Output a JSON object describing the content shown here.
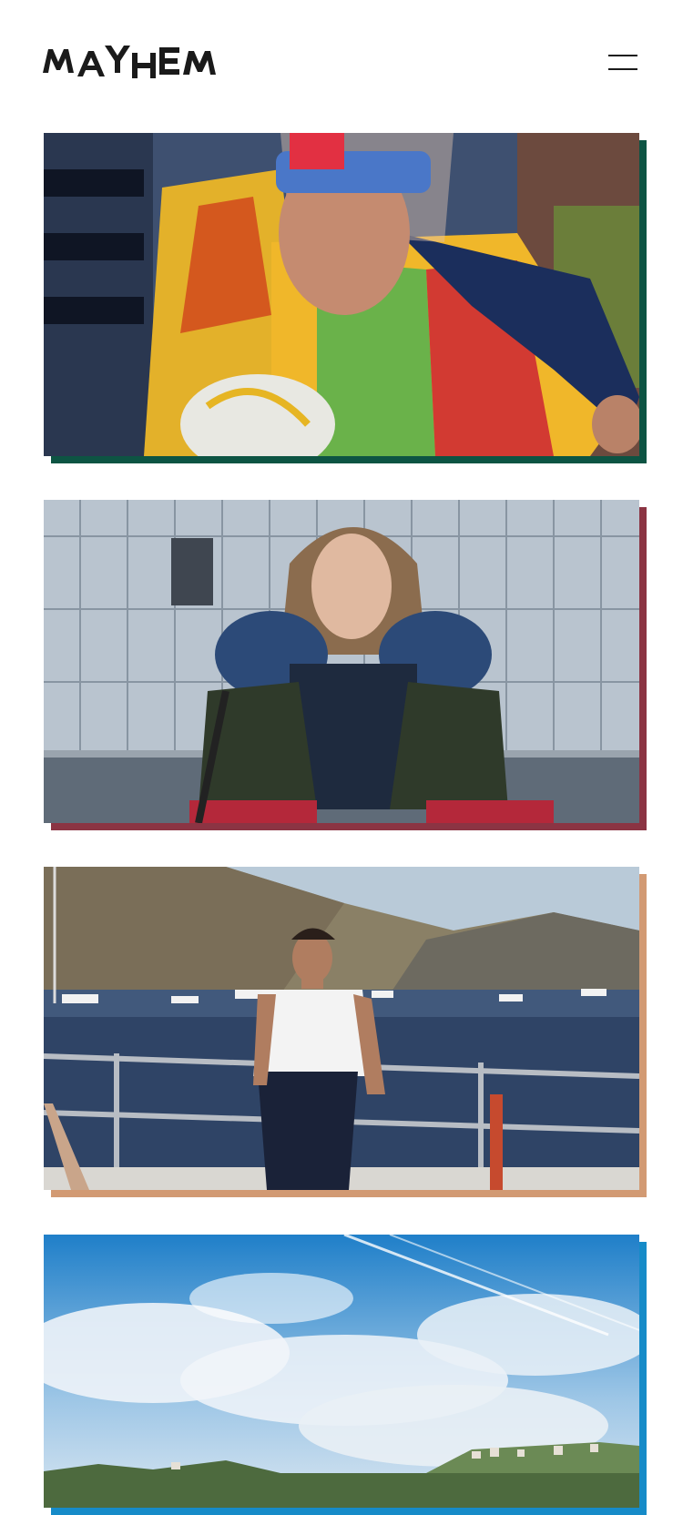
{
  "header": {
    "logo_text": "MAYHEM",
    "menu_icon": "hamburger-menu-icon"
  },
  "stories": [
    {
      "subject": "rugby-player-photo",
      "accent": "#0d5443"
    },
    {
      "subject": "hockey-player-photo",
      "accent": "#8b3443"
    },
    {
      "subject": "yacht-man-photo",
      "accent": "#d29a73"
    },
    {
      "subject": "coastal-sky-photo",
      "accent": "#168bc8"
    }
  ]
}
